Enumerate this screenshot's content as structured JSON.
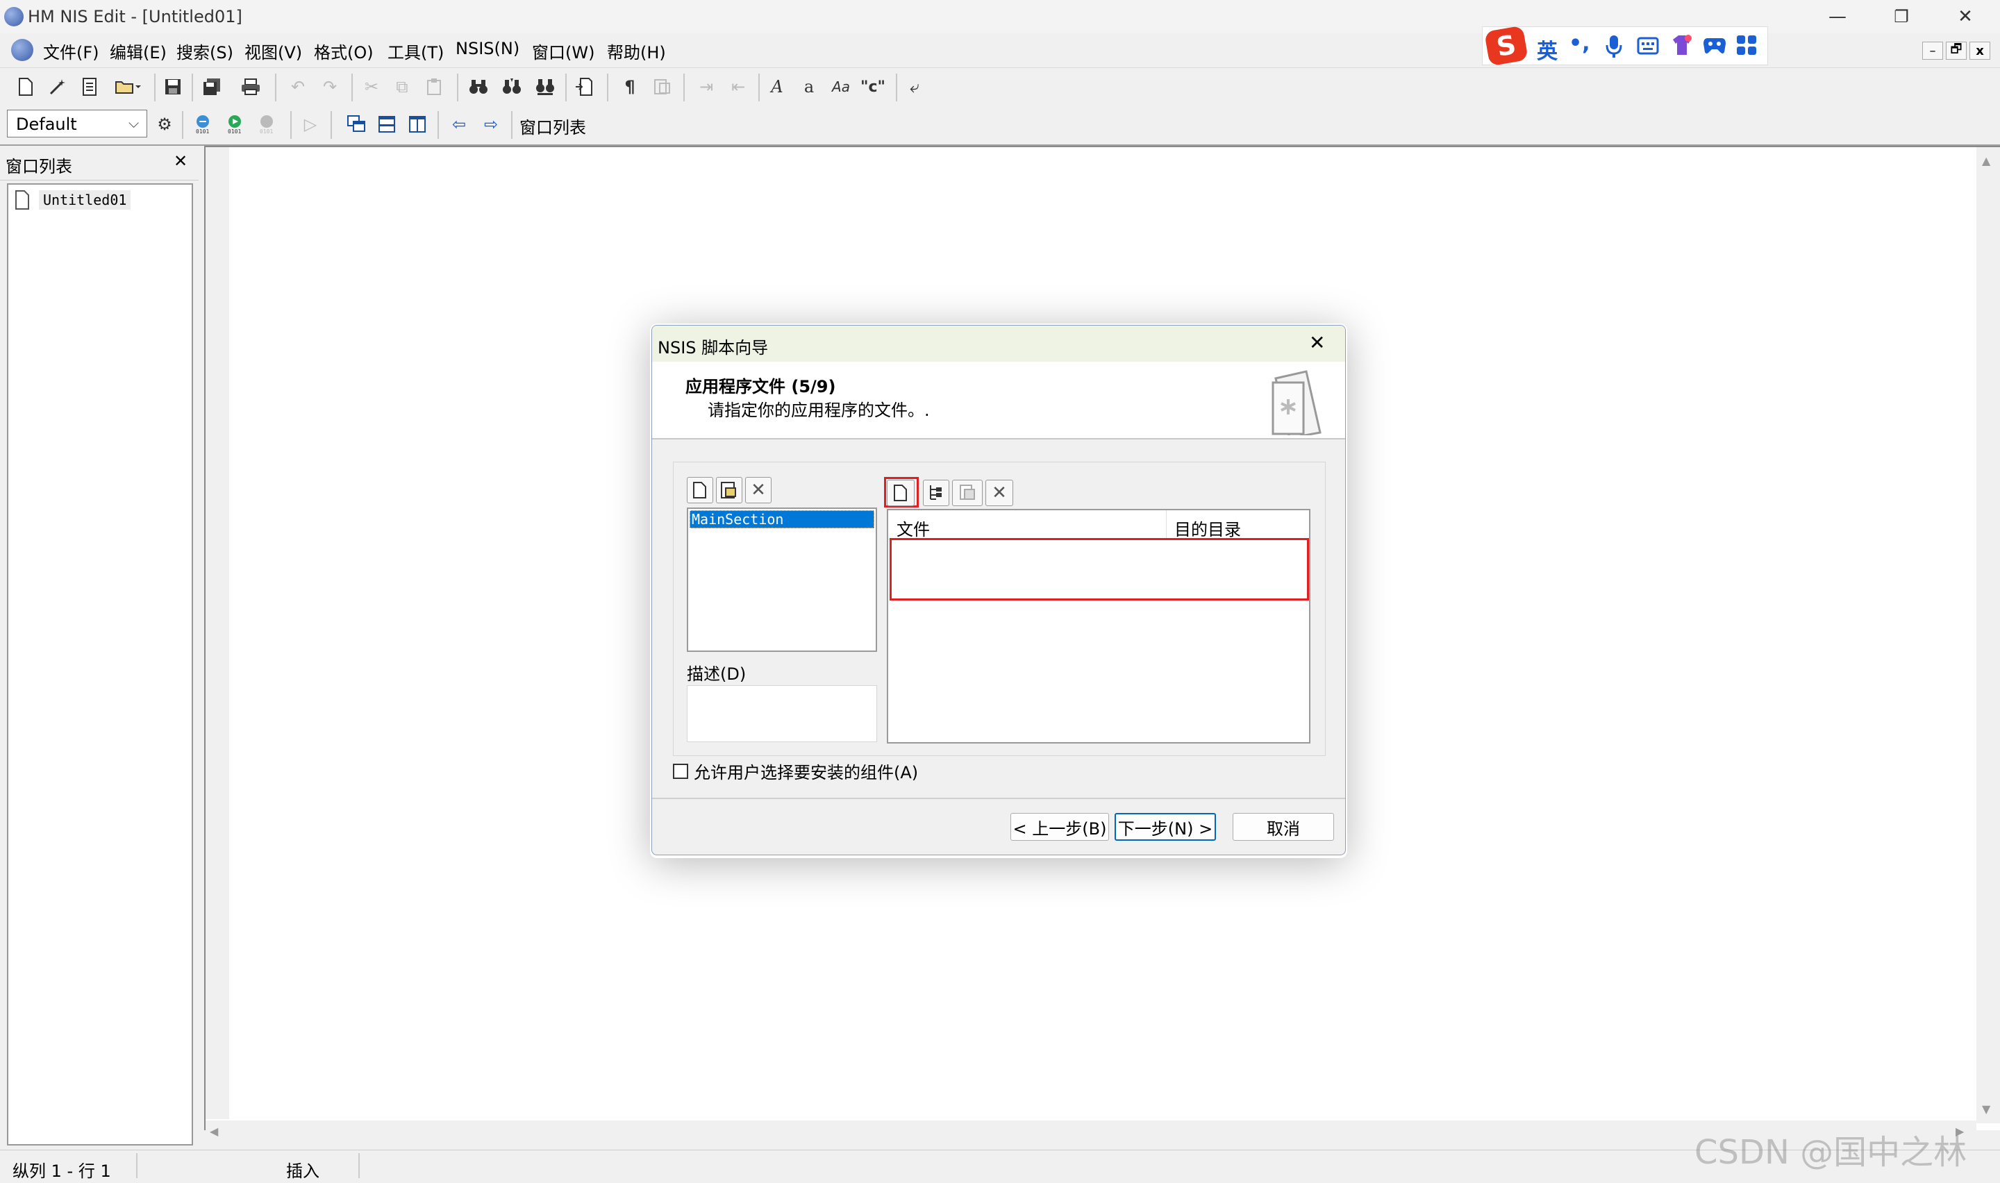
{
  "window": {
    "title": "HM NIS Edit - [Untitled01]",
    "min": "—",
    "max": "❐",
    "close": "✕"
  },
  "menu": [
    "文件(F)",
    "编辑(E)",
    "搜索(S)",
    "视图(V)",
    "格式(O)",
    "工具(T)",
    "NSIS(N)",
    "窗口(W)",
    "帮助(H)"
  ],
  "ime": {
    "lang": "英",
    "punct": "•,",
    "mdi_min": "–",
    "mdi_restore": "🗗",
    "mdi_close": "x"
  },
  "toolbar2": {
    "combo_value": "Default",
    "window_list_button": "窗口列表"
  },
  "sidepanel": {
    "title": "窗口列表",
    "close": "✕",
    "items": [
      "Untitled01"
    ]
  },
  "statusbar": {
    "position": "纵列 1 - 行 1",
    "mode": "插入"
  },
  "watermark": "CSDN @国中之林",
  "dialog": {
    "title": "NSIS 脚本向导",
    "close": "✕",
    "heading": "应用程序文件 (5/9)",
    "subheading": "请指定你的应用程序的文件。.",
    "sections": [
      "MainSection"
    ],
    "description_label": "描述(D)",
    "file_columns": [
      "文件",
      "目的目录"
    ],
    "allow_select_label": "允许用户选择要安装的组件(A)",
    "allow_select_checked": false,
    "back_button": "< 上一步(B)",
    "next_button": "下一步(N) >",
    "cancel_button": "取消"
  }
}
